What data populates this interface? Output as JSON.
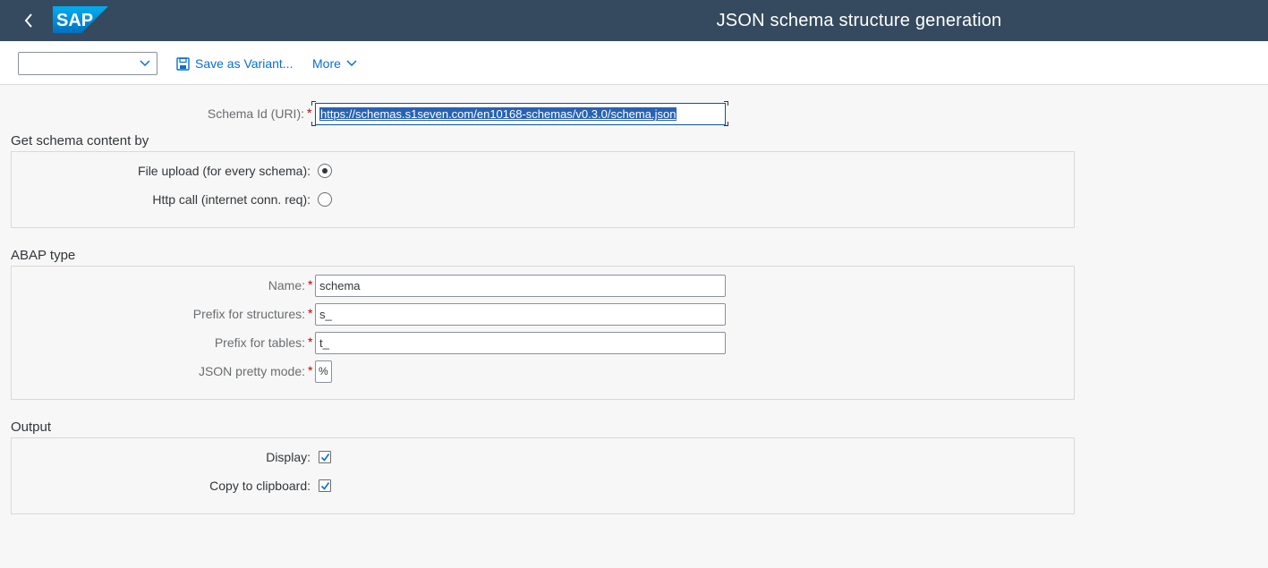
{
  "shell": {
    "title": "JSON schema structure generation",
    "logo_text": "SAP"
  },
  "toolbar": {
    "variant_value": "",
    "save_variant_label": "Save as Variant...",
    "more_label": "More"
  },
  "schema": {
    "label": "Schema Id (URI):",
    "value": "https://schemas.s1seven.com/en10168-schemas/v0.3.0/schema.json"
  },
  "get_content": {
    "title": "Get schema content by",
    "options": [
      {
        "label": "File upload (for every schema):",
        "selected": true
      },
      {
        "label": "Http call (internet conn. req):",
        "selected": false
      }
    ]
  },
  "abap_type": {
    "title": "ABAP type",
    "fields": [
      {
        "label": "Name:",
        "value": "schema"
      },
      {
        "label": "Prefix for structures:",
        "value": "s_"
      },
      {
        "label": "Prefix for tables:",
        "value": "t_"
      },
      {
        "label": "JSON pretty mode:",
        "value": "%"
      }
    ]
  },
  "output": {
    "title": "Output",
    "options": [
      {
        "label": "Display:",
        "checked": true
      },
      {
        "label": "Copy to clipboard:",
        "checked": true
      }
    ]
  },
  "colors": {
    "shell_bg": "#354a5f",
    "link": "#0a6ed1",
    "required": "#bb0000",
    "selection": "#2862b4"
  }
}
